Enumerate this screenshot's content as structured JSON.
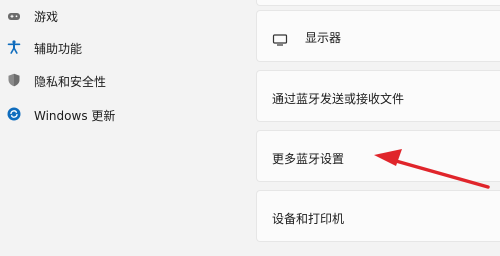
{
  "sidebar": {
    "items": [
      {
        "label": "游戏",
        "icon": "game-controller-icon"
      },
      {
        "label": "辅助功能",
        "icon": "accessibility-icon"
      },
      {
        "label": "隐私和安全性",
        "icon": "shield-icon"
      },
      {
        "label": "Windows 更新",
        "icon": "windows-update-icon"
      }
    ]
  },
  "main": {
    "cards": [
      {
        "label": ""
      },
      {
        "label": "显示器",
        "icon": "display-icon"
      },
      {
        "label": "通过蓝牙发送或接收文件"
      },
      {
        "label": "更多蓝牙设置"
      },
      {
        "label": "设备和打印机"
      }
    ]
  },
  "colors": {
    "background": "#f3f3f3",
    "card": "#fbfbfb",
    "accent": "#0067c0",
    "arrow": "#e0252b"
  }
}
